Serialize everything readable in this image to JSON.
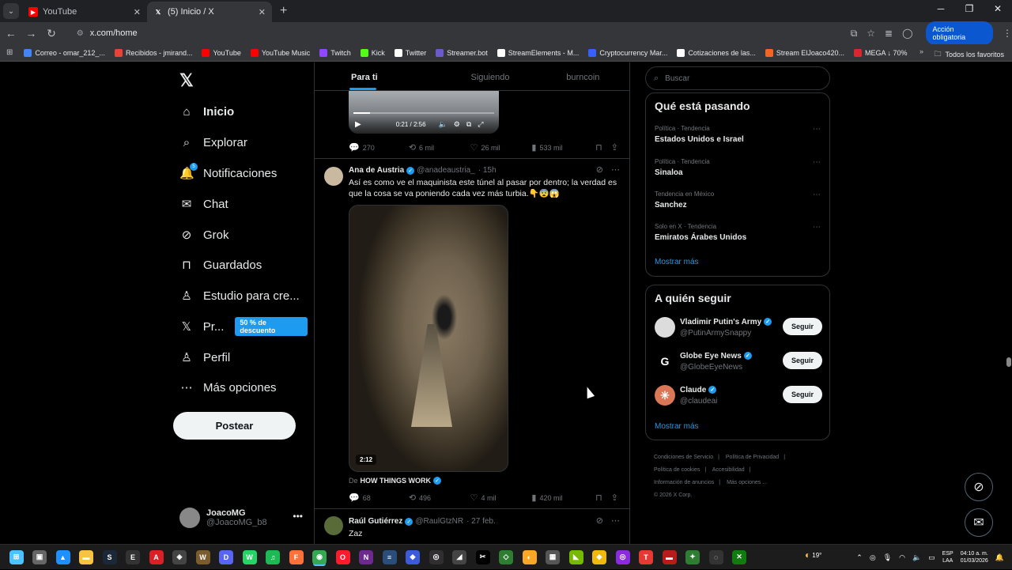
{
  "browser": {
    "tabs": [
      {
        "title": "YouTube",
        "favicon": "youtube-icon",
        "color": "#ff0000"
      },
      {
        "title": "(5) Inicio / X",
        "favicon": "x-icon",
        "color": "#ffffff"
      }
    ],
    "url": "x.com/home",
    "action_button": "Acción obligatoria",
    "bookmarks": [
      {
        "label": "Correo - omar_212_...",
        "color": "#4285f4"
      },
      {
        "label": "Recibidos - jmirand...",
        "color": "#ea4335"
      },
      {
        "label": "YouTube",
        "color": "#ff0000"
      },
      {
        "label": "YouTube Music",
        "color": "#ff0000"
      },
      {
        "label": "Twitch",
        "color": "#9146ff"
      },
      {
        "label": "Kick",
        "color": "#53fc18"
      },
      {
        "label": "Twitter",
        "color": "#ffffff"
      },
      {
        "label": "Streamer.bot",
        "color": "#6a5acd"
      },
      {
        "label": "StreamElements - M...",
        "color": "#ffffff"
      },
      {
        "label": "Cryptocurrency Mar...",
        "color": "#3861fb"
      },
      {
        "label": "Cotizaciones de las...",
        "color": "#ffffff"
      },
      {
        "label": "Stream ElJoaco420...",
        "color": "#f26522"
      },
      {
        "label": "MEGA ↓ 70%",
        "color": "#d9272e"
      }
    ],
    "all_favorites": "Todos los favoritos"
  },
  "nav": {
    "items": [
      {
        "label": "Inicio",
        "icon": "home-icon",
        "glyph": "⌂"
      },
      {
        "label": "Explorar",
        "icon": "search-icon",
        "glyph": "⌕"
      },
      {
        "label": "Notificaciones",
        "icon": "bell-icon",
        "glyph": "🔔"
      },
      {
        "label": "Chat",
        "icon": "mail-icon",
        "glyph": "✉"
      },
      {
        "label": "Grok",
        "icon": "grok-icon",
        "glyph": "⊘"
      },
      {
        "label": "Guardados",
        "icon": "bookmark-icon",
        "glyph": "⊓"
      },
      {
        "label": "Estudio para cre...",
        "icon": "studio-icon",
        "glyph": "♙"
      },
      {
        "label": "Pr...",
        "icon": "x-premium-icon",
        "glyph": "𝕏"
      },
      {
        "label": "Perfil",
        "icon": "person-icon",
        "glyph": "♙"
      },
      {
        "label": "Más opciones",
        "icon": "more-circle-icon",
        "glyph": "⋯"
      }
    ],
    "notif_badge": "5",
    "premium_promo": "50 % de descuento",
    "post_label": "Postear",
    "account_name": "JoacoMG",
    "account_handle": "@JoacoMG_b8"
  },
  "feed": {
    "tabs": [
      "Para ti",
      "Siguiendo",
      "burncoin"
    ],
    "top_video": {
      "time": "0:21 / 2:56",
      "progress": 0.12
    },
    "top_actions": {
      "replies": "270",
      "reposts": "6 mil",
      "likes": "26 mil",
      "views": "533 mil"
    },
    "tweet1": {
      "name": "Ana de Austria",
      "handle": "@anadeaustria_",
      "time": "· 15h",
      "text": "Así es como ve el maquinista este túnel al pasar por dentro; la verdad es que la cosa se va poniendo cada vez más turbia.👇😨😱",
      "duration": "2:12",
      "source_prefix": "De",
      "source_name": "HOW THINGS WORK",
      "replies": "68",
      "reposts": "496",
      "likes": "4 mil",
      "views": "420 mil"
    },
    "tweet2": {
      "name": "Raúl Gutiérrez",
      "handle": "@RaulGtzNR",
      "time": "· 27 feb.",
      "text": "Zaz"
    }
  },
  "sidebar": {
    "search_placeholder": "Buscar",
    "trends_title": "Qué está pasando",
    "trends": [
      {
        "meta": "Política · Tendencia",
        "topic": "Estados Unidos e Israel"
      },
      {
        "meta": "Política · Tendencia",
        "topic": "Sinaloa"
      },
      {
        "meta": "Tendencia en México",
        "topic": "Sanchez"
      },
      {
        "meta": "Solo en X · Tendencia",
        "topic": "Emiratos Árabes Unidos"
      }
    ],
    "show_more": "Mostrar más",
    "follow_title": "A quién seguir",
    "follow": [
      {
        "name": "Vladimir Putin's Army",
        "handle": "@PutinArmySnappy",
        "button": "Seguir",
        "avatar_color": "#dcdcdc",
        "avatar_glyph": ""
      },
      {
        "name": "Globe Eye News",
        "handle": "@GlobeEyeNews",
        "button": "Seguir",
        "avatar_color": "#000000",
        "avatar_glyph": "G"
      },
      {
        "name": "Claude",
        "handle": "@claudeai",
        "button": "Seguir",
        "avatar_color": "#d97757",
        "avatar_glyph": "✳"
      }
    ],
    "footer": [
      "Condiciones de Servicio",
      "Política de Privacidad",
      "Política de cookies",
      "Accesibilidad",
      "Información de anuncios",
      "Más opciones ...",
      "© 2026 X Corp."
    ]
  },
  "taskbar": {
    "weather_temp": "19°",
    "language": "ESP",
    "language_sub": "LAA",
    "time": "04:10 a. m.",
    "date": "01/03/2026",
    "icons": [
      {
        "name": "windows-start-icon",
        "color": "#4cc2ff",
        "glyph": "⊞"
      },
      {
        "name": "task-view-icon",
        "color": "#666",
        "glyph": "▣"
      },
      {
        "name": "photos-icon",
        "color": "#1e90ff",
        "glyph": "▲"
      },
      {
        "name": "file-explorer-icon",
        "color": "#f6c343",
        "glyph": "▬"
      },
      {
        "name": "steam-icon",
        "color": "#1b2838",
        "glyph": "S"
      },
      {
        "name": "epic-games-icon",
        "color": "#333",
        "glyph": "E"
      },
      {
        "name": "adobe-icon",
        "color": "#da1f26",
        "glyph": "A"
      },
      {
        "name": "unity-icon",
        "color": "#444",
        "glyph": "◈"
      },
      {
        "name": "warcraft-icon",
        "color": "#7a5c2e",
        "glyph": "W"
      },
      {
        "name": "discord-icon",
        "color": "#5865f2",
        "glyph": "D"
      },
      {
        "name": "whatsapp-icon",
        "color": "#25d366",
        "glyph": "W"
      },
      {
        "name": "spotify-icon",
        "color": "#1db954",
        "glyph": "♫"
      },
      {
        "name": "firefox-icon",
        "color": "#ff7139",
        "glyph": "F"
      },
      {
        "name": "chrome-icon",
        "color": "#34a853",
        "glyph": "◉"
      },
      {
        "name": "opera-icon",
        "color": "#ff1b2d",
        "glyph": "O"
      },
      {
        "name": "nf-icon",
        "color": "#6b2a8c",
        "glyph": "N"
      },
      {
        "name": "audio-mixer-icon",
        "color": "#2a4d7a",
        "glyph": "≡"
      },
      {
        "name": "app-icon-1",
        "color": "#3b5bdb",
        "glyph": "◆"
      },
      {
        "name": "obs-icon",
        "color": "#302e31",
        "glyph": "◎"
      },
      {
        "name": "app-icon-2",
        "color": "#444",
        "glyph": "◢"
      },
      {
        "name": "capcut-icon",
        "color": "#000",
        "glyph": "✂"
      },
      {
        "name": "app-icon-3",
        "color": "#2e7d32",
        "glyph": "◇"
      },
      {
        "name": "shield-app-icon",
        "color": "#f9a825",
        "glyph": "◐"
      },
      {
        "name": "app-icon-4",
        "color": "#555",
        "glyph": "▦"
      },
      {
        "name": "nvidia-icon",
        "color": "#76b900",
        "glyph": "◣"
      },
      {
        "name": "binance-icon",
        "color": "#f0b90b",
        "glyph": "◆"
      },
      {
        "name": "app-icon-5",
        "color": "#8a2be2",
        "glyph": "◎"
      },
      {
        "name": "tiktok-icon",
        "color": "#e53935",
        "glyph": "T"
      },
      {
        "name": "app-icon-6",
        "color": "#b71c1c",
        "glyph": "▬"
      },
      {
        "name": "app-icon-7",
        "color": "#2e7d32",
        "glyph": "✦"
      },
      {
        "name": "app-icon-8",
        "color": "#333",
        "glyph": "◌"
      },
      {
        "name": "xbox-icon",
        "color": "#107c10",
        "glyph": "✕"
      }
    ]
  }
}
